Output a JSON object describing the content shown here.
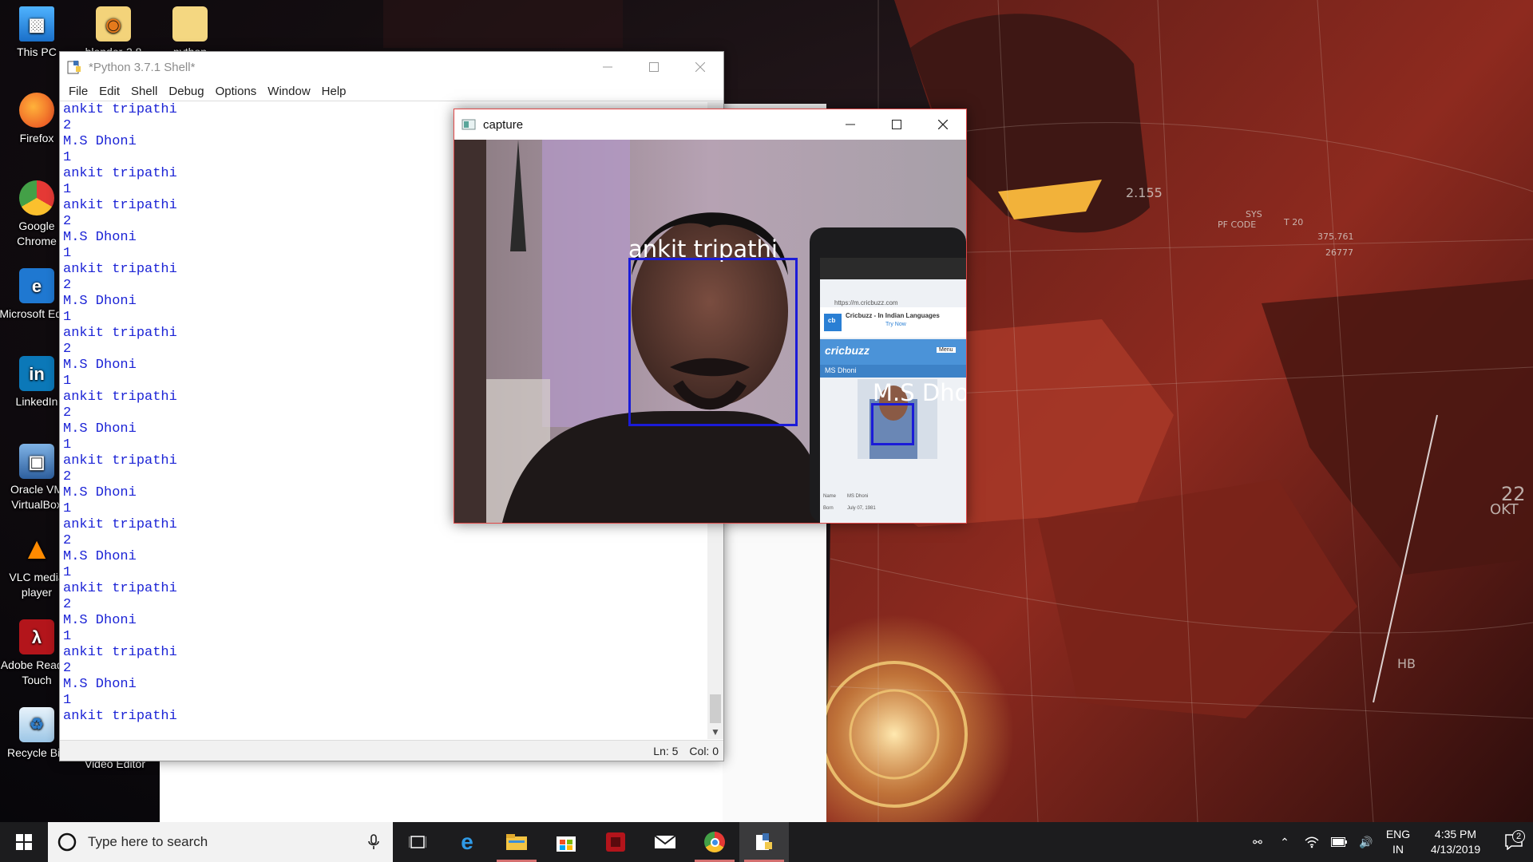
{
  "desktop": {
    "icons": [
      {
        "label": "This PC",
        "icon": "this-pc-icon"
      },
      {
        "label": "blender-2.8",
        "icon": "blender-folder-icon"
      },
      {
        "label": "python",
        "icon": "folder-icon"
      },
      {
        "label": "Firefox",
        "icon": "firefox-icon"
      },
      {
        "label": "Google Chrome",
        "icon": "chrome-icon"
      },
      {
        "label": "Microsoft Edge",
        "icon": "edge-icon"
      },
      {
        "label": "LinkedIn",
        "icon": "linkedin-icon"
      },
      {
        "label": "Oracle VM VirtualBox",
        "icon": "virtualbox-icon"
      },
      {
        "label": "VLC media player",
        "icon": "vlc-icon"
      },
      {
        "label": "Adobe Reader Touch",
        "icon": "adobe-reader-icon"
      },
      {
        "label": "Recycle Bin",
        "icon": "recycle-bin-icon"
      },
      {
        "label": "Video Editor",
        "icon": "video-editor-icon"
      }
    ],
    "wallpaper_text": [
      "2.155",
      "PF CODE",
      "375.761",
      "26777",
      "SYS",
      "T 20",
      "HB",
      "22",
      "OKT"
    ]
  },
  "shell": {
    "title": "*Python 3.7.1 Shell*",
    "menu": [
      "File",
      "Edit",
      "Shell",
      "Debug",
      "Options",
      "Window",
      "Help"
    ],
    "lines": [
      "ankit tripathi",
      "2",
      "M.S Dhoni",
      "1",
      "ankit tripathi",
      "1",
      "ankit tripathi",
      "2",
      "M.S Dhoni",
      "1",
      "ankit tripathi",
      "2",
      "M.S Dhoni",
      "1",
      "ankit tripathi",
      "2",
      "M.S Dhoni",
      "1",
      "ankit tripathi",
      "2",
      "M.S Dhoni",
      "1",
      "ankit tripathi",
      "2",
      "M.S Dhoni",
      "1",
      "ankit tripathi",
      "2",
      "M.S Dhoni",
      "1",
      "ankit tripathi",
      "2",
      "M.S Dhoni",
      "1",
      "ankit tripathi",
      "2",
      "M.S Dhoni",
      "1",
      "ankit tripathi"
    ],
    "status": {
      "line": "Ln: 5",
      "col": "Col: 0"
    }
  },
  "capture": {
    "title": "capture",
    "labels": {
      "person1": "ankit tripathi",
      "person2": "M.S Dhoni"
    },
    "phone": {
      "url": "https://m.cricbuzz.com",
      "banner": "Cricbuzz - In Indian Languages",
      "banner_sub": "Try Now",
      "logo": "cricbuzz",
      "menu": "Menu",
      "page_title": "MS Dhoni",
      "field_name": "Name",
      "field_name_value": "MS Dhoni",
      "field_born": "Born",
      "field_born_value": "July 07, 1981"
    }
  },
  "taskbar": {
    "search_placeholder": "Type here to search",
    "apps": [
      "task-view-icon",
      "edge-icon",
      "file-explorer-icon",
      "store-icon",
      "media-app-icon",
      "mail-icon",
      "chrome-icon",
      "python-idle-icon"
    ],
    "lang_top": "ENG",
    "lang_bottom": "IN",
    "time": "4:35 PM",
    "date": "4/13/2019",
    "notifications": "2"
  },
  "colors": {
    "accent": "#1c24d6",
    "taskbar": "#1c1c1e",
    "box": "#1b1bd8"
  }
}
